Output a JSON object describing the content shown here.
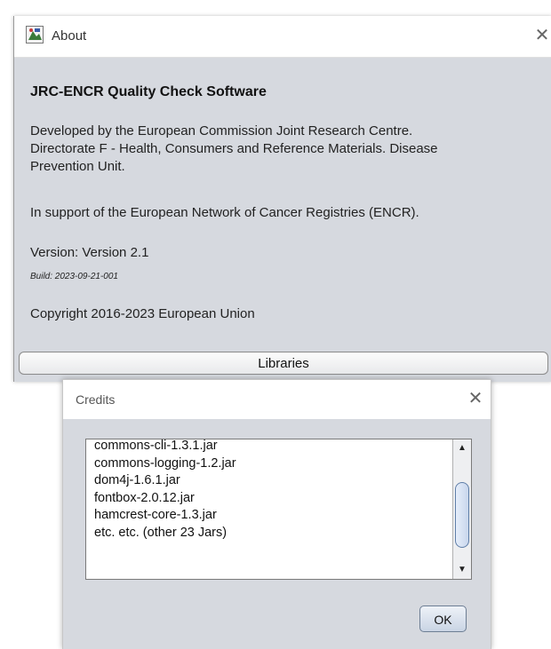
{
  "about": {
    "title": "About",
    "close": "✕",
    "heading": "JRC-ENCR Quality Check Software",
    "developed_line1": "Developed by the European Commission Joint Research Centre.",
    "developed_line2": "Directorate F - Health, Consumers and Reference Materials. Disease",
    "developed_line3": "Prevention Unit.",
    "support": "In support of the European Network of Cancer Registries (ENCR).",
    "version": "Version: Version 2.1",
    "build": "Build: 2023-09-21-001",
    "copyright": "Copyright 2016-2023 European Union",
    "libraries_button": "Libraries"
  },
  "credits": {
    "title": "Credits",
    "close": "✕",
    "libraries": [
      "commons-cli-1.3.1.jar",
      "commons-logging-1.2.jar",
      "dom4j-1.6.1.jar",
      "fontbox-2.0.12.jar",
      "hamcrest-core-1.3.jar",
      "etc. etc. (other 23 Jars)"
    ],
    "scroll_up": "▲",
    "scroll_down": "▼",
    "ok_button": "OK"
  }
}
